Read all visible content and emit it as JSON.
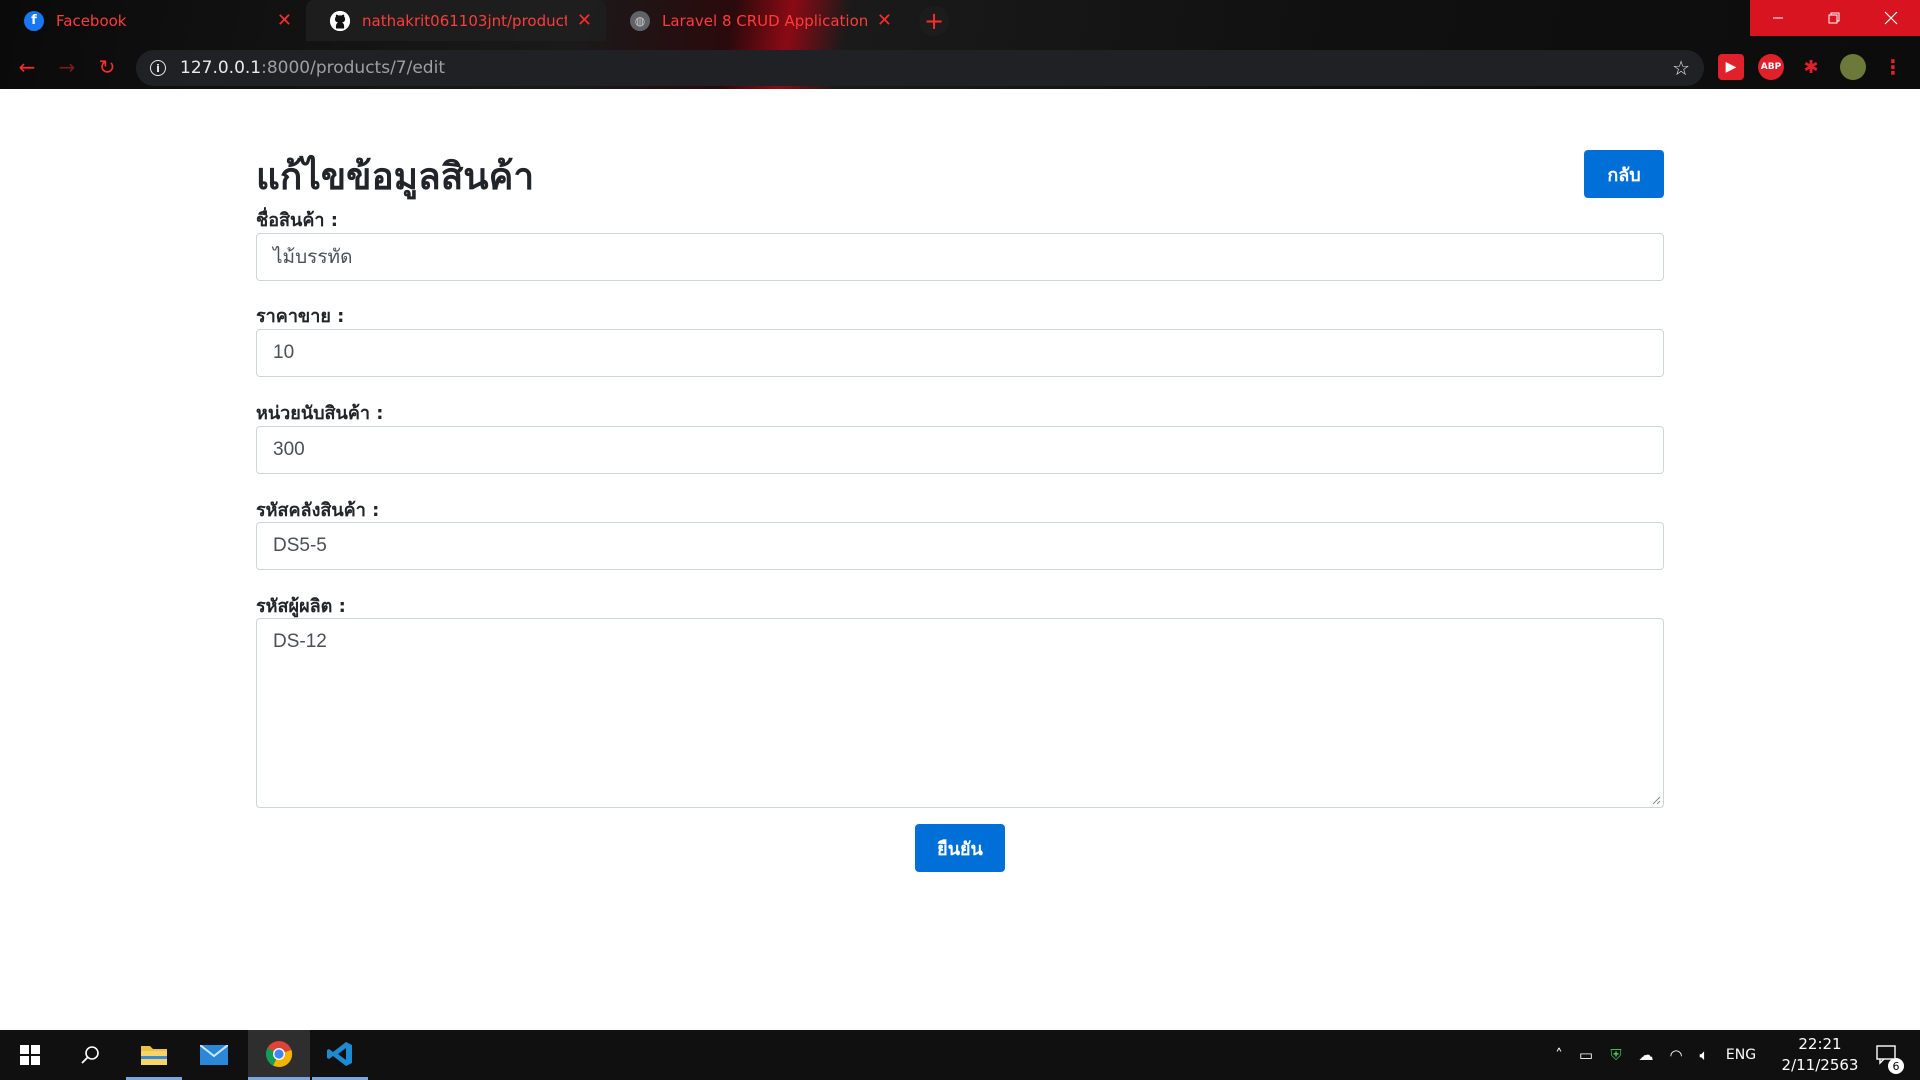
{
  "browser": {
    "tabs": [
      {
        "title": "Facebook",
        "icon": "facebook-icon"
      },
      {
        "title": "nathakrit061103jnt/products_lara",
        "icon": "github-icon"
      },
      {
        "title": "Laravel 8 CRUD Application - ItS",
        "icon": "globe-icon"
      }
    ],
    "new_tab": "+",
    "url_host": "127.0.0.1",
    "url_path": ":8000/products/7/edit",
    "extensions": [
      {
        "name": "youtube-extension-icon",
        "label": "▶",
        "color": "#e0202a"
      },
      {
        "name": "adblock-plus-icon",
        "label": "ABP",
        "color": "#e0202a"
      },
      {
        "name": "puzzle-extension-icon",
        "label": "✱",
        "color": "#e0202a"
      }
    ]
  },
  "page": {
    "title": "แก้ไขข้อมูลสินค้า",
    "back_label": "กลับ",
    "submit_label": "ยืนยัน",
    "fields": [
      {
        "label": "ชื่อสินค้า :",
        "value": "ไม้บรรทัด"
      },
      {
        "label": "ราคาขาย :",
        "value": "10"
      },
      {
        "label": "หน่วยนับสินค้า :",
        "value": "300"
      },
      {
        "label": "รหัสคลังสินค้า :",
        "value": "DS5-5"
      },
      {
        "label": "รหัสผู้ผลิต :",
        "value": "DS-12"
      }
    ],
    "accent_color": "#0070d8"
  },
  "taskbar": {
    "language": "ENG",
    "time": "22:21",
    "date": "2/11/2563",
    "notification_count": "6"
  }
}
